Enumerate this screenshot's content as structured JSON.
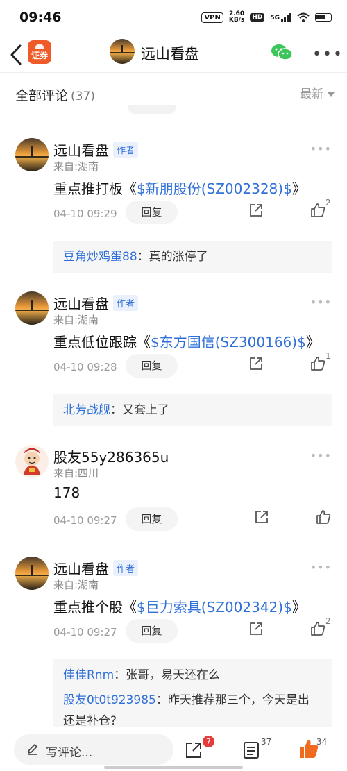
{
  "status_bar": {
    "time": "09:46",
    "vpn": "VPN",
    "net_speed_value": "2.60",
    "net_speed_unit": "KB/s",
    "hd": "HD",
    "network": "5G"
  },
  "nav": {
    "app_logo_text": "证券",
    "title": "远山看盘"
  },
  "section": {
    "title": "全部评论",
    "count": "(37)",
    "sort_label": "最新"
  },
  "comments": [
    {
      "author": "远山看盘",
      "badge": "作者",
      "location": "来自:湖南",
      "content_prefix": "重点推打板《",
      "stock": "$新朋股份(SZ002328)$",
      "content_suffix": "》",
      "time": "04-10 09:29",
      "reply_label": "回复",
      "likes": "2",
      "replies": [
        {
          "user": "豆角炒鸡蛋88",
          "text": "：真的涨停了"
        }
      ]
    },
    {
      "author": "远山看盘",
      "badge": "作者",
      "location": "来自:湖南",
      "content_prefix": "重点低位跟踪《",
      "stock": "$东方国信(SZ300166)$",
      "content_suffix": "》",
      "time": "04-10 09:28",
      "reply_label": "回复",
      "likes": "1",
      "replies": [
        {
          "user": "北芳战舰",
          "text": "：又套上了"
        }
      ]
    },
    {
      "author": "股友55y286365u",
      "location": "来自:四川",
      "content": "178",
      "time": "04-10 09:27",
      "reply_label": "回复"
    },
    {
      "author": "远山看盘",
      "badge": "作者",
      "location": "来自:湖南",
      "content_prefix": "重点推个股《",
      "stock": "$巨力索具(SZ002342)$",
      "content_suffix": "》",
      "time": "04-10 09:27",
      "reply_label": "回复",
      "likes": "2",
      "replies": [
        {
          "user": "佳佳Rnm",
          "text": "：张哥，易天还在么"
        },
        {
          "user": "股友0t0t923985",
          "text": "：昨天推荐那三个，今天是出",
          "text_line2": "还是补仓?"
        }
      ]
    }
  ],
  "bottom_bar": {
    "write_placeholder": "写评论...",
    "share_badge": "7",
    "comments_count": "37",
    "likes_count": "34"
  },
  "colors": {
    "link_blue": "#2f6fd8",
    "accent_orange": "#f05a28",
    "like_orange": "#f06a20",
    "badge_red": "#e63b3b"
  },
  "icons": [
    "back-icon",
    "wechat-icon",
    "more-icon",
    "share-icon",
    "thumbs-up-icon",
    "pen-icon",
    "list-icon"
  ]
}
